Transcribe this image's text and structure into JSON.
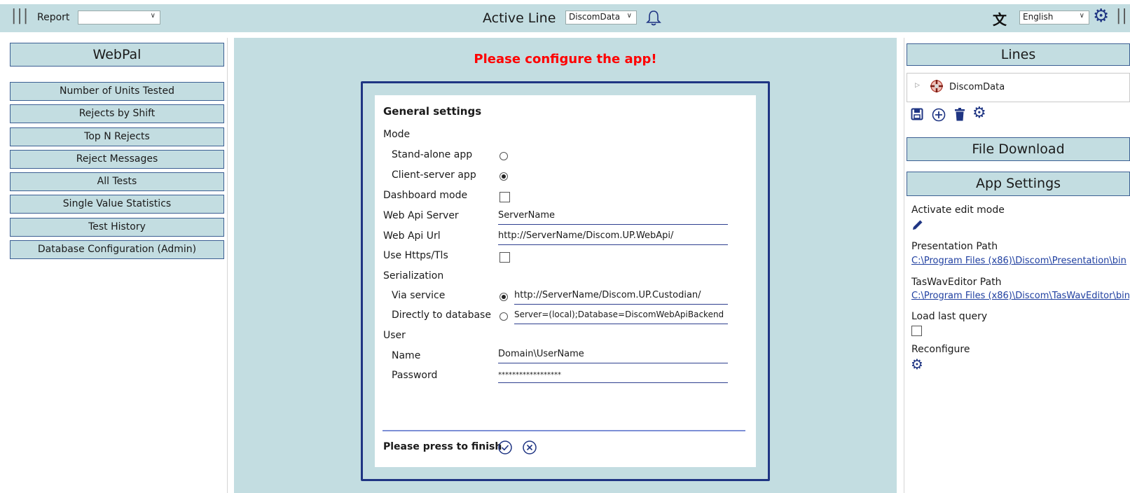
{
  "topbar": {
    "menu_icon": "hamburger-icon",
    "report_label": "Report",
    "report_value": "",
    "active_line_label": "Active Line",
    "active_line_value": "DiscomData",
    "language_value": "English",
    "bell_icon": "bell-icon",
    "translate_icon": "translate-icon",
    "settings_icon": "gear-icon"
  },
  "left": {
    "title": "WebPal",
    "items": [
      "Number of Units Tested",
      "Rejects by Shift",
      "Top N Rejects",
      "Reject Messages",
      "All Tests",
      "Single Value Statistics",
      "Test History",
      "Database Configuration (Admin)"
    ]
  },
  "center": {
    "warning": "Please configure the app!",
    "warning_color": "#ff0000",
    "dialog": {
      "title": "General settings",
      "mode_label": "Mode",
      "standalone_label": "Stand-alone app",
      "clientserver_label": "Client-server app",
      "dashboard_label": "Dashboard mode",
      "webapi_server_label": "Web Api Server",
      "webapi_server_value": "ServerName",
      "webapi_url_label": "Web Api Url",
      "webapi_url_value": "http://ServerName/Discom.UP.WebApi/",
      "https_label": "Use Https/Tls",
      "serialization_label": "Serialization",
      "via_service_label": "Via service",
      "via_service_value": "http://ServerName/Discom.UP.Custodian/",
      "direct_db_label": "Directly to database",
      "direct_db_value": "Server=(local);Database=DiscomWebApiBackend",
      "user_label": "User",
      "name_label": "Name",
      "name_value": "Domain\\UserName",
      "password_label": "Password",
      "password_value": "******************",
      "finish_label": "Please press to finish",
      "accept_icon": "check-circle-icon",
      "cancel_icon": "x-circle-icon"
    }
  },
  "right": {
    "lines_title": "Lines",
    "line_item": "DiscomData",
    "file_download_title": "File Download",
    "app_settings_title": "App Settings",
    "activate_edit_label": "Activate edit mode",
    "presentation_path_label": "Presentation Path",
    "presentation_path_value": "C:\\Program Files (x86)\\Discom\\Presentation\\bin",
    "taswav_path_label": "TasWavEditor Path",
    "taswav_path_value": "C:\\Program Files (x86)\\Discom\\TasWavEditor\\bin",
    "load_last_query_label": "Load last query",
    "reconfigure_label": "Reconfigure"
  },
  "colors": {
    "panel_bg": "#c3dde1",
    "border_blue": "#3c5f93",
    "dialog_border": "#1f3583",
    "link": "#1f3fa0"
  }
}
